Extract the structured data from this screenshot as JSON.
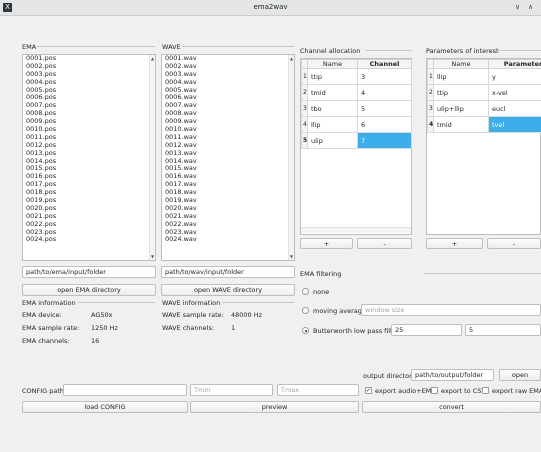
{
  "window": {
    "title": "ema2wav"
  },
  "ema": {
    "group_label": "EMA",
    "files": [
      "0001.pos",
      "0002.pos",
      "0003.pos",
      "0004.pos",
      "0005.pos",
      "0006.pos",
      "0007.pos",
      "0008.pos",
      "0009.pos",
      "0010.pos",
      "0011.pos",
      "0012.pos",
      "0013.pos",
      "0014.pos",
      "0015.pos",
      "0016.pos",
      "0017.pos",
      "0018.pos",
      "0019.pos",
      "0020.pos",
      "0021.pos",
      "0022.pos",
      "0023.pos",
      "0024.pos"
    ],
    "path": "path/to/ema/input/folder",
    "open_button": "open EMA directory",
    "info_label": "EMA information",
    "device_label": "EMA device:",
    "device_value": "AG50x",
    "rate_label": "EMA sample rate:",
    "rate_value": "1250 Hz",
    "channels_label": "EMA channels:",
    "channels_value": "16"
  },
  "wave": {
    "group_label": "WAVE",
    "files": [
      "0001.wav",
      "0002.wav",
      "0003.wav",
      "0004.wav",
      "0005.wav",
      "0006.wav",
      "0007.wav",
      "0008.wav",
      "0009.wav",
      "0010.wav",
      "0011.wav",
      "0012.wav",
      "0013.wav",
      "0014.wav",
      "0015.wav",
      "0016.wav",
      "0017.wav",
      "0018.wav",
      "0019.wav",
      "0020.wav",
      "0021.wav",
      "0022.wav",
      "0023.wav",
      "0024.wav"
    ],
    "path": "path/to/wav/input/folder",
    "open_button": "open WAVE directory",
    "info_label": "WAVE information",
    "rate_label": "WAVE sample rate:",
    "rate_value": "48000 Hz",
    "channels_label": "WAVE channels:",
    "channels_value": "1"
  },
  "channel_allocation": {
    "label": "Channel allocation",
    "headers": [
      "Name",
      "Channel"
    ],
    "rows": [
      {
        "index": "1",
        "name": "ttip",
        "channel": "3"
      },
      {
        "index": "2",
        "name": "tmid",
        "channel": "4"
      },
      {
        "index": "3",
        "name": "tbo",
        "channel": "5"
      },
      {
        "index": "4",
        "name": "llip",
        "channel": "6"
      },
      {
        "index": "5",
        "name": "ulip",
        "channel": "7"
      }
    ],
    "add_label": "+",
    "remove_label": "-"
  },
  "parameters": {
    "label": "Parameters of interest",
    "headers": [
      "Name",
      "Parameter"
    ],
    "rows": [
      {
        "index": "1",
        "name": "llip",
        "param": "y"
      },
      {
        "index": "2",
        "name": "ttip",
        "param": "x-vel"
      },
      {
        "index": "3",
        "name": "ulip+llip",
        "param": "eucl"
      },
      {
        "index": "4",
        "name": "tmid",
        "param": "tvel"
      }
    ],
    "add_label": "+",
    "remove_label": "-"
  },
  "filtering": {
    "label": "EMA filtering",
    "none_label": "none",
    "moving_average_label": "moving average",
    "window_placeholder": "window size",
    "butterworth_label": "Butterworth low pass filter",
    "butterworth_value1": "25",
    "butterworth_value2": "5",
    "selected": "butterworth"
  },
  "output": {
    "label": "output directory:",
    "path": "path/to/output/folder",
    "open_button": "open"
  },
  "config": {
    "label": "CONFIG path:",
    "path_value": "",
    "tmin_placeholder": "Tmin",
    "tmax_placeholder": "Tmax",
    "load_button": "load CONFIG",
    "preview_button": "preview",
    "convert_button": "convert"
  },
  "export": {
    "audio_ema_label": "export audio+EMA",
    "audio_ema_checked": true,
    "csv_label": "export to CSV",
    "csv_checked": false,
    "raw_label": "export raw EMA",
    "raw_checked": false
  }
}
